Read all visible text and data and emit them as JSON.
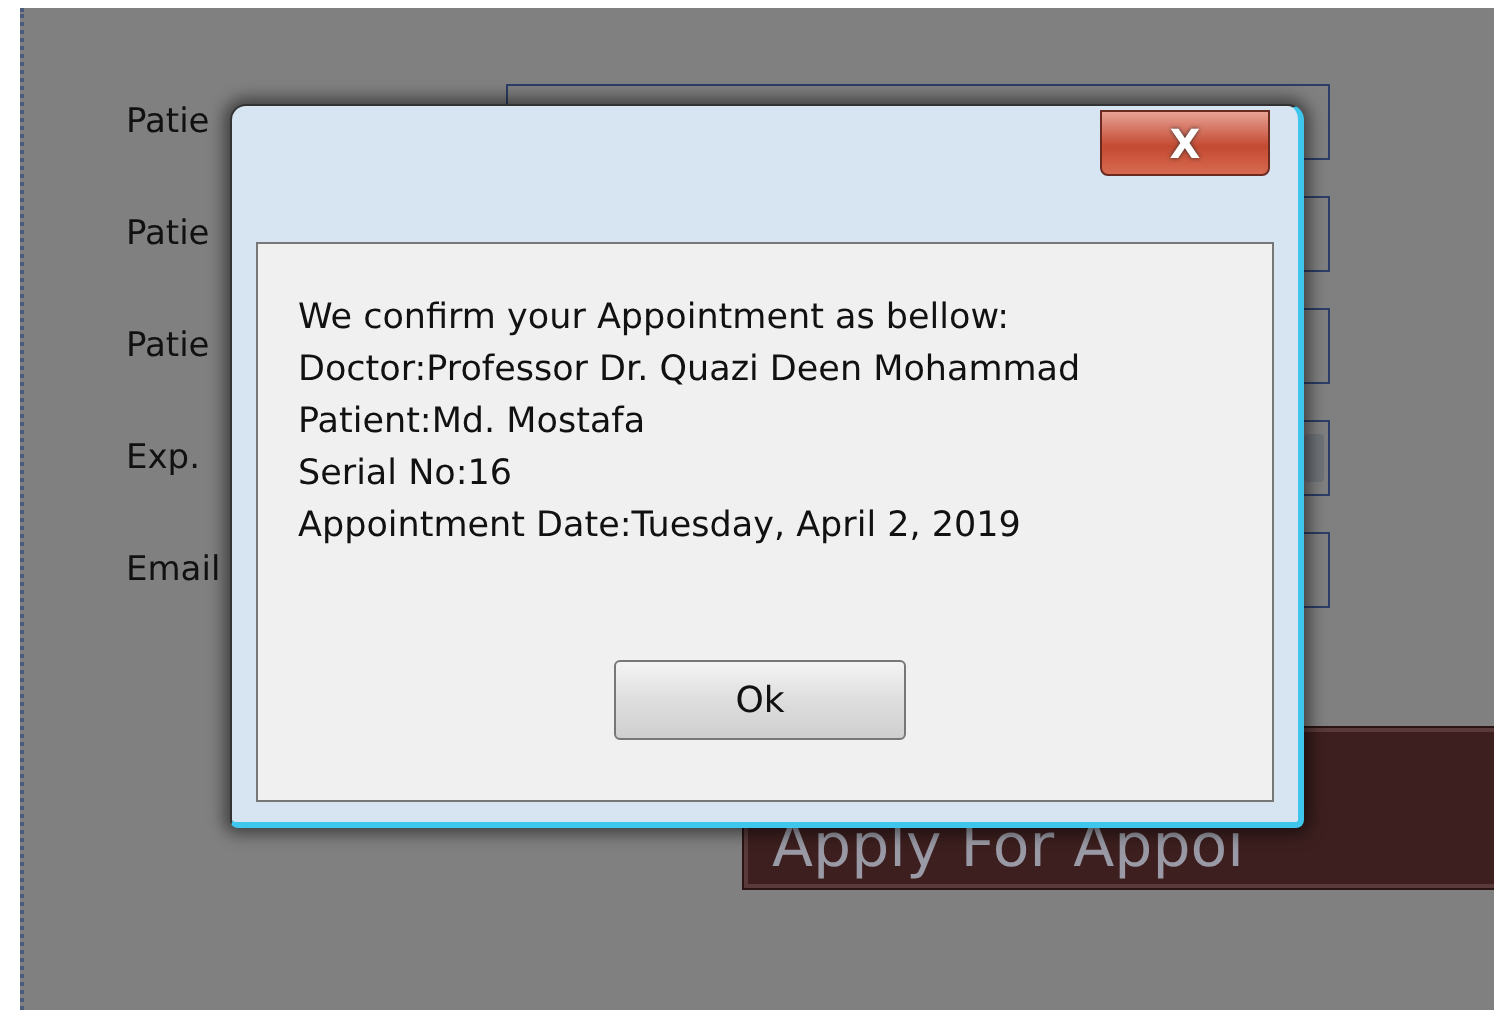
{
  "form": {
    "fields": [
      {
        "label": "Patie",
        "kind": "text"
      },
      {
        "label": "Patie",
        "kind": "text"
      },
      {
        "label": "Patie",
        "kind": "text"
      },
      {
        "label": "Exp.",
        "kind": "dropdown"
      },
      {
        "label": "Email",
        "kind": "text"
      }
    ],
    "submit": "Apply For Appoi"
  },
  "dialog": {
    "lines": [
      "We confirm your Appointment as bellow:",
      "Doctor:Professor Dr. Quazi Deen Mohammad",
      "Patient:Md. Mostafa",
      "Serial No:16",
      "Appointment Date:Tuesday, April 2, 2019"
    ],
    "close": "X",
    "button": "Ok"
  }
}
